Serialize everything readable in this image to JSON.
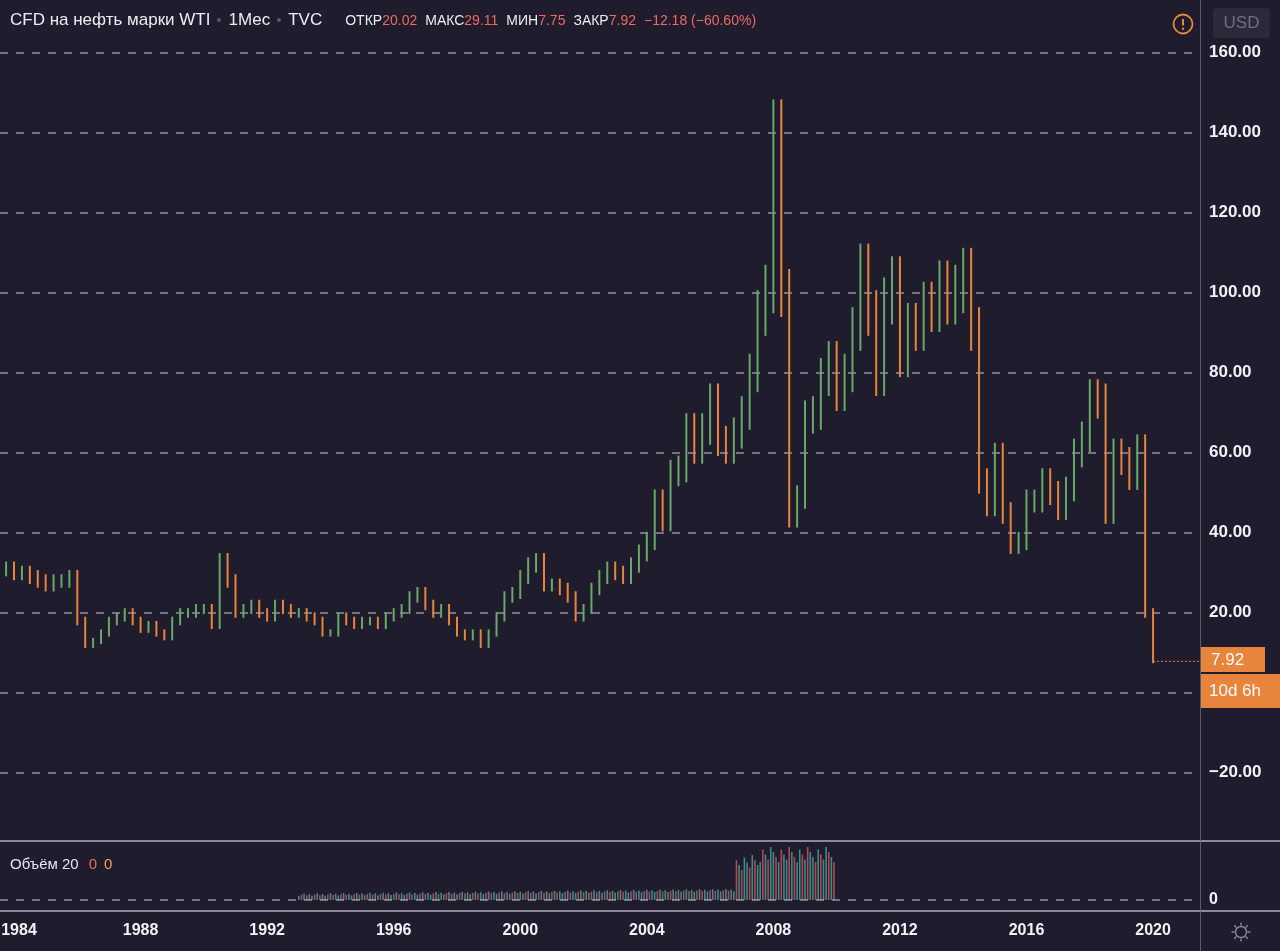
{
  "header": {
    "symbol": "CFD на нефть марки WTI",
    "interval": "1Мес",
    "exchange": "TVC",
    "ohlc": [
      {
        "label": "ОТКР",
        "value": "20.02"
      },
      {
        "label": "МАКС",
        "value": "29.11"
      },
      {
        "label": "МИН",
        "value": "7.75"
      },
      {
        "label": "ЗАКР",
        "value": "7.92"
      }
    ],
    "change": "−12.18 (−60.60%)"
  },
  "currency_button": "USD",
  "price_axis": {
    "positive_labels": [
      "160.00",
      "140.00",
      "120.00",
      "100.00",
      "80.00",
      "60.00",
      "40.00",
      "20.00"
    ],
    "negative_labels": [
      "−20.00"
    ]
  },
  "last_price": {
    "label": "7.92",
    "countdown": "10d 6h"
  },
  "volume_pane": {
    "title": "Объём 20",
    "value_1": "0",
    "value_2": "0",
    "axis_label": "0"
  },
  "time_axis": [
    "1984",
    "1988",
    "1992",
    "1996",
    "2000",
    "2004",
    "2008",
    "2012",
    "2016",
    "2020"
  ]
}
